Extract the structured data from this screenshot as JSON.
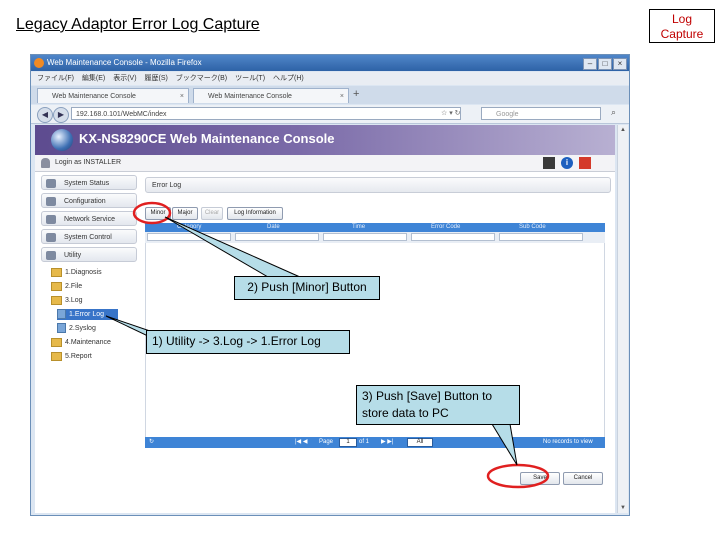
{
  "slide": {
    "title": "Legacy Adaptor Error Log Capture",
    "corner_label": "Log\nCapture"
  },
  "browser": {
    "window_title": "Web Maintenance Console - Mozilla Firefox",
    "menu": [
      "ファイル(F)",
      "編集(E)",
      "表示(V)",
      "履歴(S)",
      "ブックマーク(B)",
      "ツール(T)",
      "ヘルプ(H)"
    ],
    "tabs": [
      {
        "label": "Web Maintenance Console"
      },
      {
        "label": "Web Maintenance Console"
      }
    ],
    "new_tab_symbol": "+",
    "url": "192.168.0.101/WebMC/index",
    "search_placeholder": "Google"
  },
  "app": {
    "title": "KX-NS8290CE Web Maintenance Console",
    "user_label": "Login as INSTALLER",
    "info_symbol": "i",
    "nav": [
      {
        "label": "System Status"
      },
      {
        "label": "Configuration"
      },
      {
        "label": "Network Service"
      },
      {
        "label": "System Control"
      },
      {
        "label": "Utility"
      }
    ],
    "tree": [
      {
        "label": "1.Diagnosis"
      },
      {
        "label": "2.File"
      },
      {
        "label": "3.Log"
      },
      {
        "label": "1.Error Log"
      },
      {
        "label": "2.Syslog"
      },
      {
        "label": "4.Maintenance"
      },
      {
        "label": "5.Report"
      }
    ],
    "panel_title": "Error Log",
    "buttons": {
      "minor": "Minor",
      "major": "Major",
      "clear": "Clear",
      "log_information": "Log Information",
      "save": "Save",
      "cancel": "Cancel"
    },
    "columns": [
      "Category",
      "Date",
      "Time",
      "Error Code",
      "Sub Code"
    ],
    "pager": {
      "page_label": "Page",
      "page_value": "1",
      "of_label": "of 1",
      "page_size": "All",
      "status": "No records to view"
    }
  },
  "callouts": {
    "step1": "1) Utility -> 3.Log -> 1.Error Log",
    "step2": "2) Push [Minor] Button",
    "step3": "3) Push [Save] Button to store data to PC"
  }
}
